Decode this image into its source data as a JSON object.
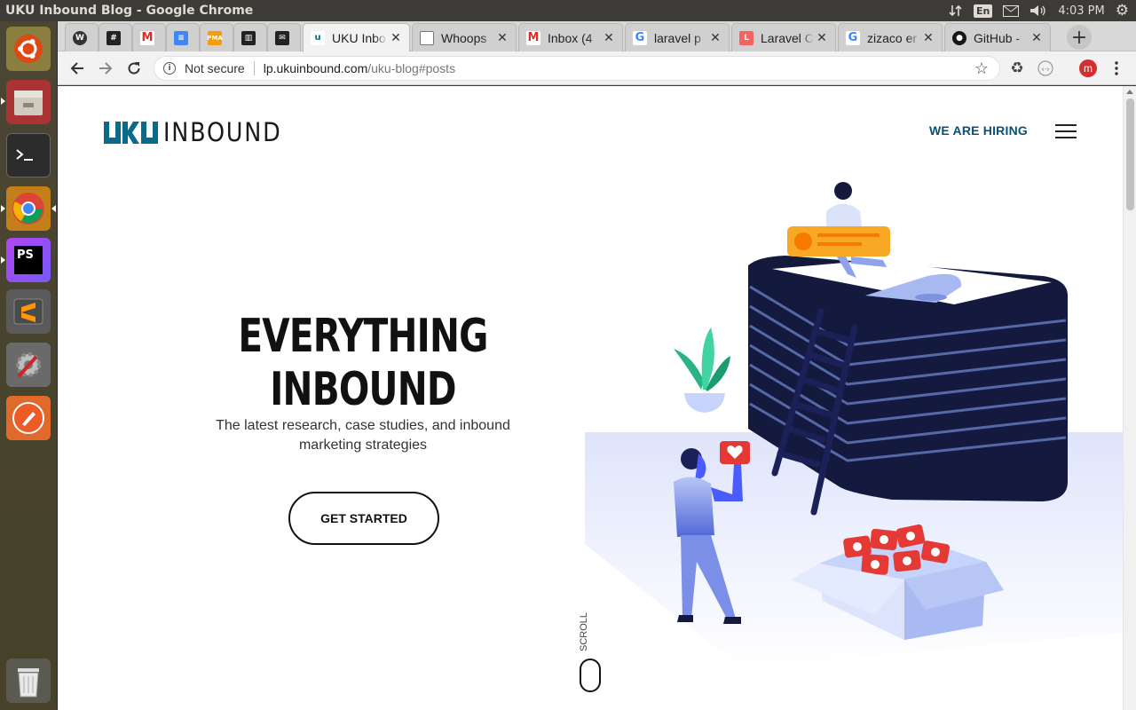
{
  "window": {
    "title": "UKU Inbound Blog - Google Chrome"
  },
  "system_tray": {
    "language": "En",
    "time": "4:03 PM",
    "icons": [
      "network-arrows-icon",
      "keyboard-language-icon",
      "mail-icon",
      "volume-icon",
      "settings-gear-icon"
    ]
  },
  "launcher": {
    "items": [
      {
        "name": "ubuntu-dash-icon"
      },
      {
        "name": "files-icon"
      },
      {
        "name": "terminal-icon"
      },
      {
        "name": "chrome-icon"
      },
      {
        "name": "phpstorm-icon",
        "label": "PS"
      },
      {
        "name": "sublime-text-icon"
      },
      {
        "name": "system-settings-icon"
      },
      {
        "name": "postman-icon"
      },
      {
        "name": "trash-icon"
      }
    ]
  },
  "tabs": [
    {
      "label": "",
      "favicon": "wordpress-icon",
      "color": "#3a3a3a"
    },
    {
      "label": "",
      "favicon": "slack-hash-icon",
      "color": "#4a154b"
    },
    {
      "label": "",
      "favicon": "gmail-icon",
      "color": "#d93025"
    },
    {
      "label": "",
      "favicon": "docs-icon",
      "color": "#4285f4"
    },
    {
      "label": "",
      "favicon": "phpmyadmin-icon",
      "color": "#f89c0e"
    },
    {
      "label": "",
      "favicon": "trello-icon",
      "color": "#0079bf"
    },
    {
      "label": "",
      "favicon": "mail-client-icon",
      "color": "#1b7aa6"
    },
    {
      "label": "UKU Inbo",
      "favicon": "uku-icon",
      "color": "#0a6a8a",
      "active": true
    },
    {
      "label": "Whoops",
      "favicon": "page-icon",
      "color": "#666666"
    },
    {
      "label": "Inbox (4",
      "favicon": "gmail-icon",
      "color": "#d93025"
    },
    {
      "label": "laravel p",
      "favicon": "google-icon",
      "color": "#4285f4"
    },
    {
      "label": "Laravel C",
      "favicon": "laravel-icon",
      "color": "#f4645f"
    },
    {
      "label": "zizaco er",
      "favicon": "google-icon",
      "color": "#4285f4"
    },
    {
      "label": "GitHub -",
      "favicon": "github-icon",
      "color": "#161616"
    }
  ],
  "address_bar": {
    "security_label": "Not secure",
    "url_host": "lp.ukuinbound.com",
    "url_path": "/uku-blog#posts"
  },
  "toolbar": {
    "profile_initial": "m"
  },
  "page": {
    "logo_uku": "UKU",
    "logo_inbound": "INBOUND",
    "nav_hiring": "WE ARE HIRING",
    "hero_title": "EVERYTHING INBOUND",
    "hero_subtitle": "The latest research, case studies, and inbound marketing strategies",
    "cta_label": "GET STARTED",
    "scroll_label": "SCROLL"
  },
  "colors": {
    "brand": "#0a6a8a",
    "hiring_link": "#0a5078",
    "illustration_navy": "#141a3d",
    "illustration_blue": "#4a5cff",
    "heart_red": "#e53935",
    "badge_orange": "#f9a825"
  }
}
